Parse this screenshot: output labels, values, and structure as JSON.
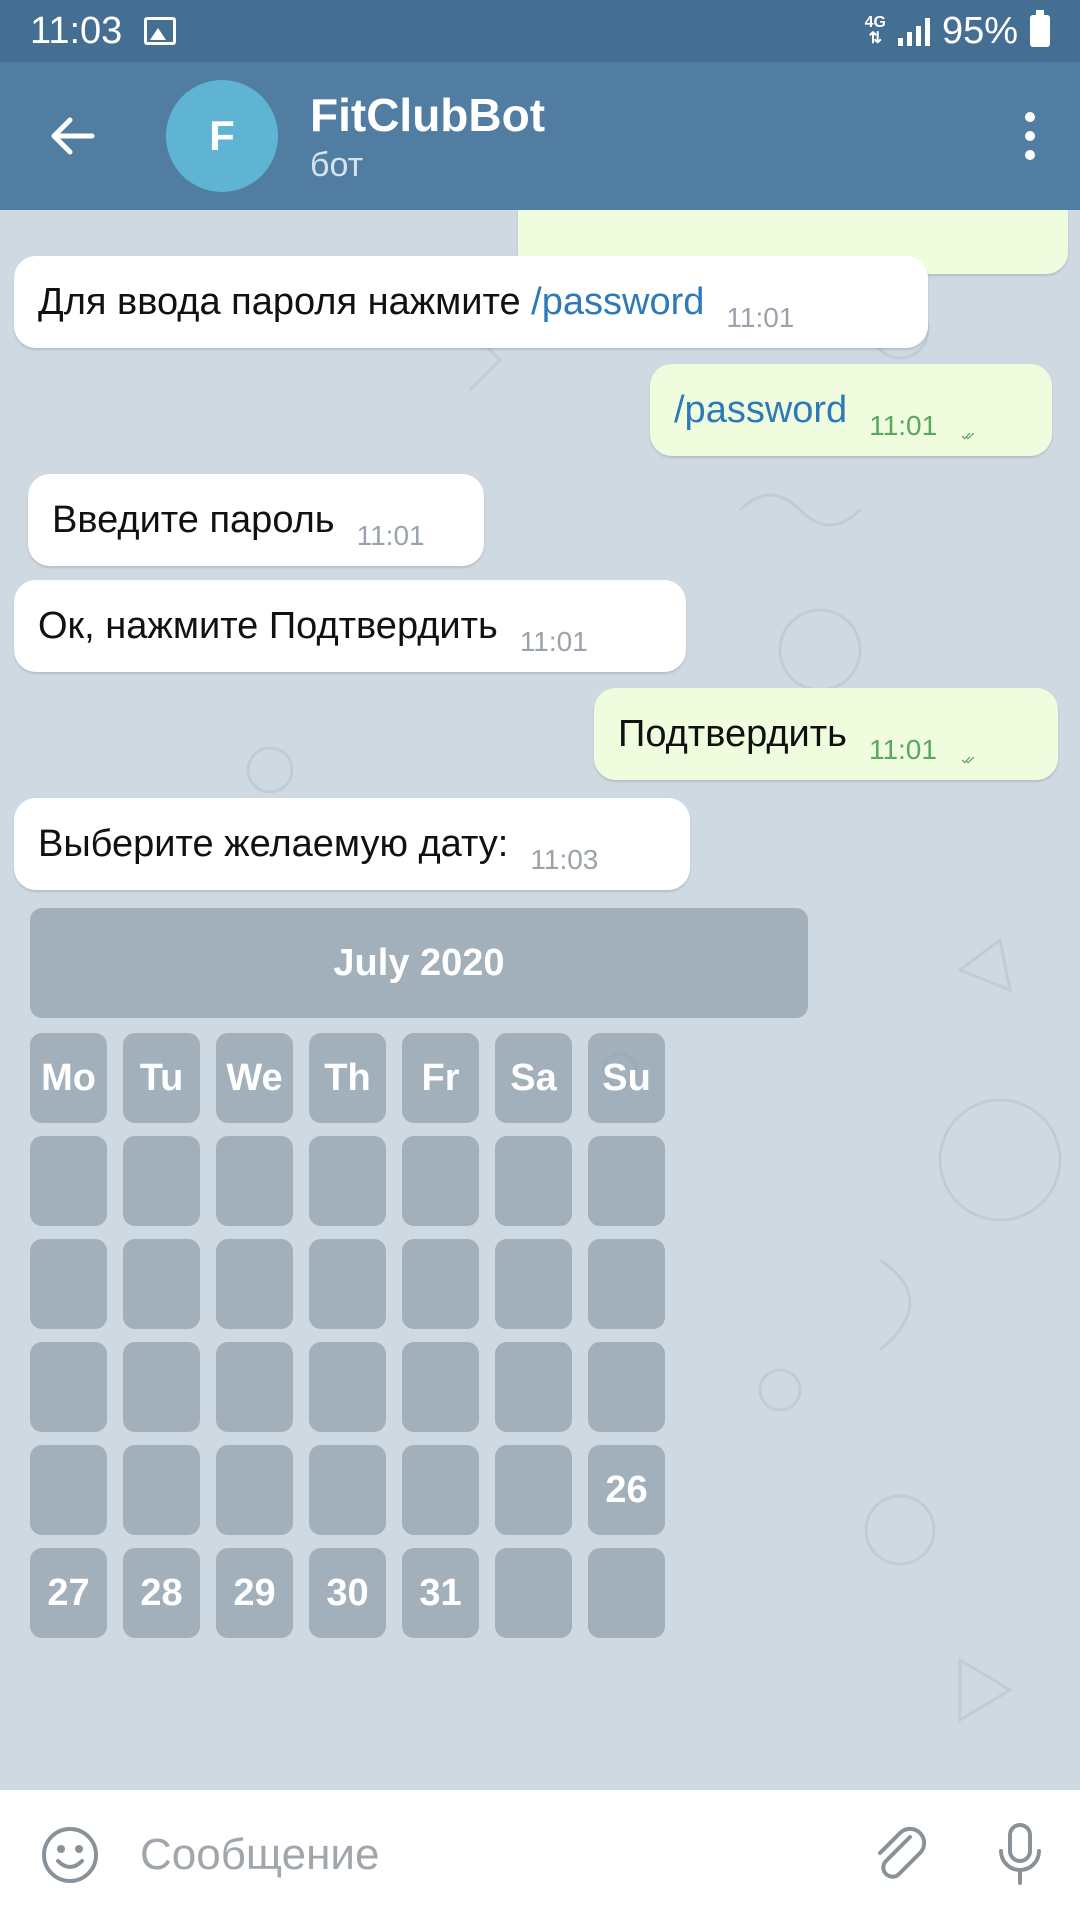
{
  "status_bar": {
    "time": "11:03",
    "network": "4G",
    "battery": "95%"
  },
  "header": {
    "avatar_letter": "F",
    "title": "FitClubBot",
    "subtitle": "бот"
  },
  "messages": [
    {
      "direction": "in",
      "text": "Для ввода пароля нажмите ",
      "link": "/password",
      "time": "11:01"
    },
    {
      "direction": "out",
      "link": "/password",
      "time": "11:01"
    },
    {
      "direction": "in",
      "text": "Введите пароль",
      "time": "11:01"
    },
    {
      "direction": "in",
      "text": "Ок, нажмите Подтвердить",
      "time": "11:01"
    },
    {
      "direction": "out",
      "text": "Подтвердить",
      "time": "11:01"
    },
    {
      "direction": "in",
      "text": "Выберите желаемую дату:",
      "time": "11:03"
    }
  ],
  "calendar": {
    "month": "July 2020",
    "weekdays": [
      "Mo",
      "Tu",
      "We",
      "Th",
      "Fr",
      "Sa",
      "Su"
    ],
    "weeks": [
      [
        "",
        "",
        "",
        "",
        "",
        "",
        ""
      ],
      [
        "",
        "",
        "",
        "",
        "",
        "",
        ""
      ],
      [
        "",
        "",
        "",
        "",
        "",
        "",
        ""
      ],
      [
        "",
        "",
        "",
        "",
        "",
        "",
        "26"
      ],
      [
        "27",
        "28",
        "29",
        "30",
        "31",
        "",
        ""
      ]
    ]
  },
  "input": {
    "placeholder": "Сообщение"
  },
  "colors": {
    "header": "#527da3",
    "status_bar": "#456f92",
    "chat_background": "#cfd9e2",
    "incoming_bubble": "#ffffff",
    "outgoing_bubble": "#effdde",
    "link": "#2e7ab8",
    "read_check": "#5aa760"
  }
}
